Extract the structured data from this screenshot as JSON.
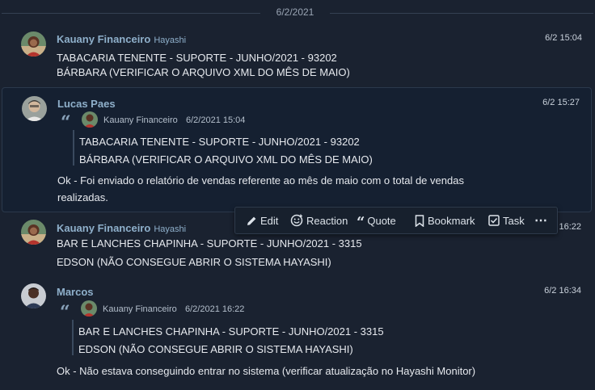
{
  "date_separator": "6/2/2021",
  "messages": [
    {
      "author": "Kauany Financeiro",
      "handle": "Hayashi",
      "time": "6/2 15:04",
      "lines": [
        "TABACARIA TENENTE - SUPORTE - JUNHO/2021 - 93202",
        "BÁRBARA (VERIFICAR O ARQUIVO XML DO MÊS DE MAIO)"
      ]
    },
    {
      "author": "Lucas Paes",
      "time": "6/2 15:27",
      "quote": {
        "author": "Kauany Financeiro",
        "time": "6/2/2021 15:04",
        "lines": [
          "TABACARIA TENENTE - SUPORTE - JUNHO/2021 - 93202",
          "BÁRBARA (VERIFICAR O ARQUIVO XML DO MÊS DE MAIO)"
        ]
      },
      "lines": [
        "Ok - Foi enviado o relatório de vendas referente ao mês de maio com o total de vendas",
        "realizadas."
      ]
    },
    {
      "author": "Kauany Financeiro",
      "handle": "Hayashi",
      "time": "16:22",
      "lines": [
        "BAR E LANCHES CHAPINHA - SUPORTE - JUNHO/2021 - 3315",
        "EDSON (NÃO CONSEGUE ABRIR O SISTEMA HAYASHI)"
      ]
    },
    {
      "author": "Marcos",
      "time": "6/2 16:34",
      "quote": {
        "author": "Kauany Financeiro",
        "time": "6/2/2021 16:22",
        "lines": [
          "BAR E LANCHES CHAPINHA - SUPORTE - JUNHO/2021 - 3315",
          "EDSON (NÃO CONSEGUE ABRIR O SISTEMA HAYASHI)"
        ]
      },
      "lines": [
        "Ok - Não estava conseguindo entrar no sistema (verificar atualização no Hayashi Monitor)"
      ]
    }
  ],
  "action_bar": {
    "edit": "Edit",
    "reaction": "Reaction",
    "quote": "Quote",
    "bookmark": "Bookmark",
    "task": "Task",
    "more": "⋯",
    "icons": [
      "pencil-icon",
      "smiley-icon",
      "quote-icon",
      "bookmark-icon",
      "checkbox-icon",
      "more-icon"
    ]
  },
  "colors": {
    "background": "#1a2230",
    "highlight": "#152031",
    "name": "#8fb0cb",
    "text": "#e6e9ee"
  }
}
